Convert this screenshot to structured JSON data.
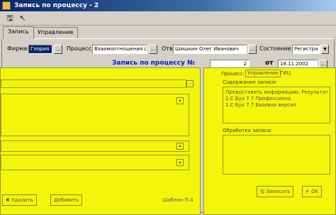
{
  "window": {
    "title": "Запись по процессу - 2"
  },
  "tabs": [
    {
      "label": "Запись"
    },
    {
      "label": "Управление"
    }
  ],
  "fields": {
    "firm": {
      "label": "Фирма:",
      "value": "Глория"
    },
    "process": {
      "label": "Процесс:",
      "value": "Взаимоотношения с"
    },
    "responsible": {
      "label": "Отв:",
      "value": "Шишкин Олег Иванович"
    },
    "status": {
      "label": "Состояние:",
      "value": "Регистра"
    }
  },
  "heading": {
    "text": "Запись по процессу №",
    "number": "2",
    "ot": "от",
    "date": "18.11.2002"
  },
  "right_panel": {
    "process_label": "Процесс:",
    "process_value": "Управление ГИЦ",
    "content_label": "Содержание записи:",
    "content_lines": [
      "Предоставить информацию. Результат",
      "1.С Бух 7.7 Профессиона",
      "1.С Бух 7.7 Базовая версия"
    ],
    "processing_label": "Обработка записи:",
    "save_label": "Записать",
    "ok_label": "OK"
  },
  "left_panel": {
    "delete_label": "Удалить",
    "add_label": "Добавить",
    "page_label": "Шаблон П.4"
  }
}
